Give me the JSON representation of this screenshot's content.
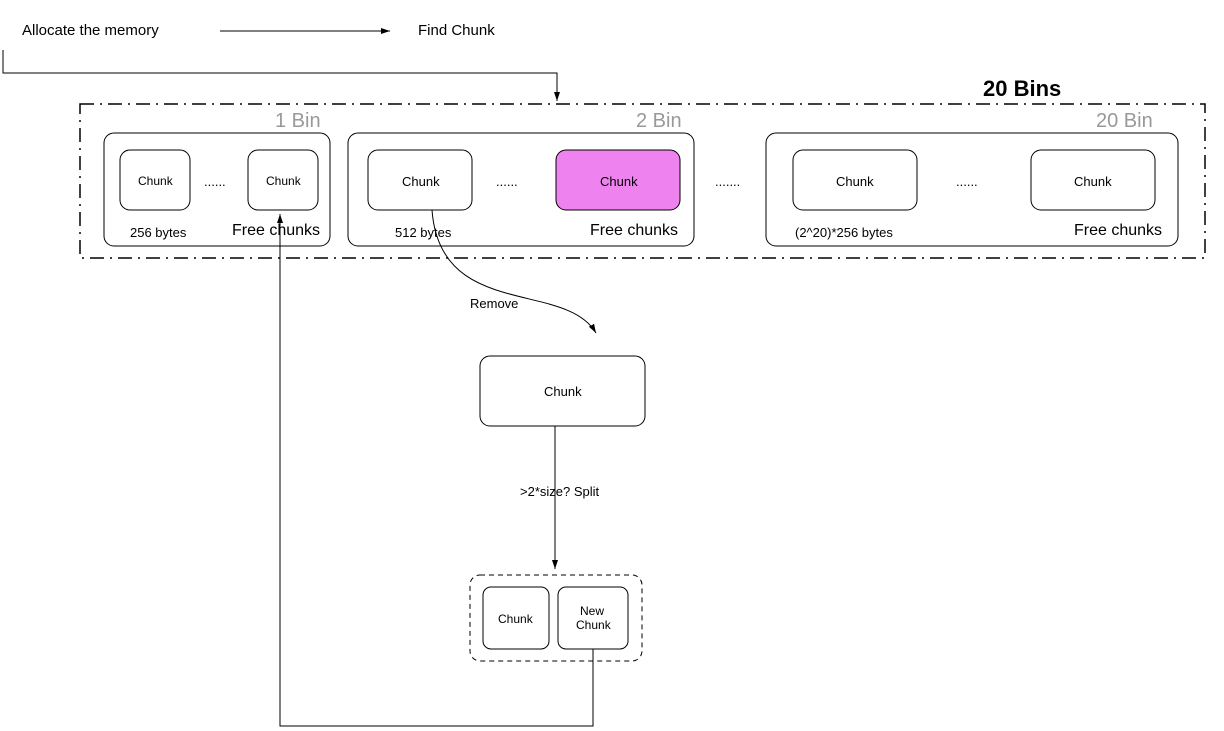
{
  "header": {
    "allocate": "Allocate the memory",
    "find": "Find Chunk",
    "bins_title": "20 Bins"
  },
  "bins": {
    "b1": {
      "title": "1 Bin",
      "chunk_a": "Chunk",
      "chunk_b": "Chunk",
      "dots": "......",
      "size": "256 bytes",
      "free": "Free chunks"
    },
    "b2": {
      "title": "2 Bin",
      "chunk_a": "Chunk",
      "chunk_b": "Chunk",
      "dots": "......",
      "size": "512 bytes",
      "free": "Free chunks"
    },
    "gap_dots": ".......",
    "b20": {
      "title": "20 Bin",
      "chunk_a": "Chunk",
      "chunk_b": "Chunk",
      "dots": "......",
      "size": "(2^20)*256 bytes",
      "free": "Free chunks"
    }
  },
  "flow": {
    "remove": "Remove",
    "mid_chunk": "Chunk",
    "split_q": ">2*size? Split",
    "split_left": "Chunk",
    "split_right_1": "New",
    "split_right_2": "Chunk"
  }
}
